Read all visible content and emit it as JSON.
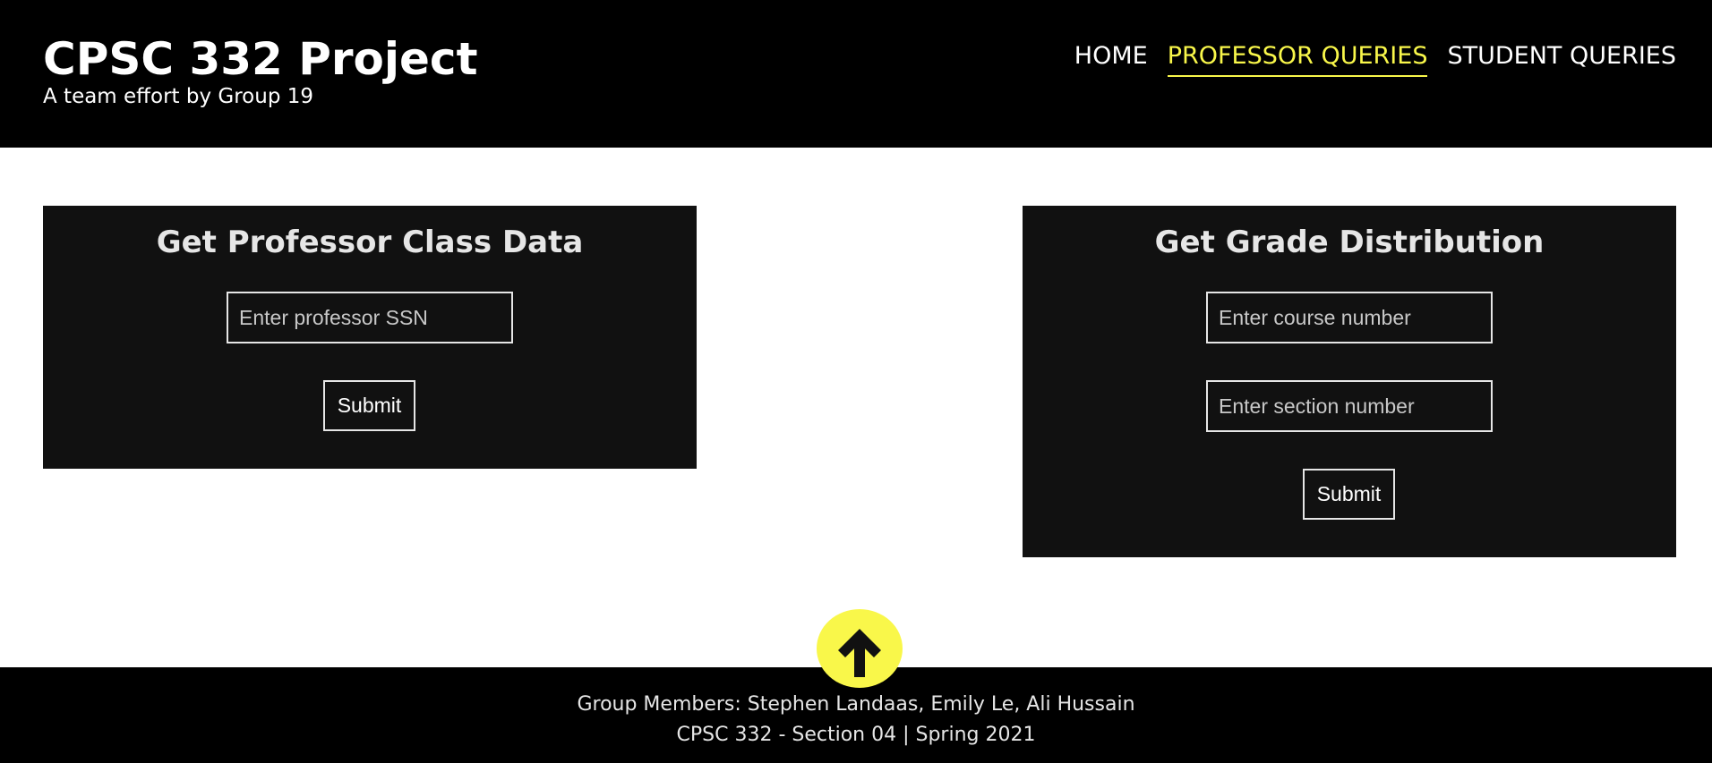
{
  "header": {
    "title": "CPSC 332 Project",
    "subtitle": "A team effort by Group 19"
  },
  "nav": {
    "items": [
      {
        "label": "HOME",
        "active": false
      },
      {
        "label": "PROFESSOR QUERIES",
        "active": true
      },
      {
        "label": "STUDENT QUERIES",
        "active": false
      }
    ]
  },
  "professor_card": {
    "title": "Get Professor Class Data",
    "ssn_placeholder": "Enter professor SSN",
    "ssn_value": "",
    "submit_label": "Submit"
  },
  "grade_card": {
    "title": "Get Grade Distribution",
    "course_placeholder": "Enter course number",
    "course_value": "",
    "section_placeholder": "Enter section number",
    "section_value": "",
    "submit_label": "Submit"
  },
  "scroll_top": {
    "icon": "arrow-up-icon"
  },
  "footer": {
    "members": "Group Members: Stephen Landaas, Emily Le, Ali Hussain",
    "course_info": "CPSC 332 - Section 04 | Spring 2021"
  },
  "colors": {
    "header_bg": "#000000",
    "card_bg": "#111111",
    "accent": "#f9f74a",
    "text_light": "#e6e6e6"
  }
}
